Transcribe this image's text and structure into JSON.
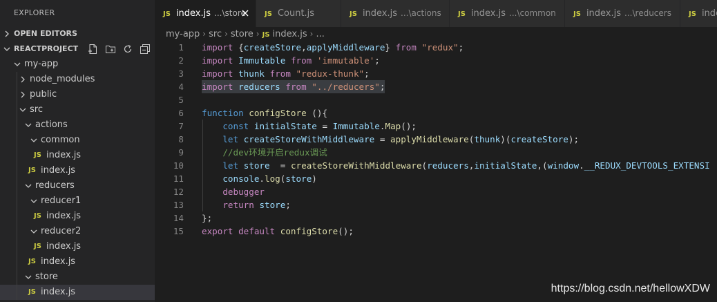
{
  "explorer": {
    "title": "EXPLORER",
    "open_editors": "OPEN EDITORS",
    "project": "REACTPROJECT",
    "tree": [
      {
        "label": "my-app",
        "type": "folder-open"
      },
      {
        "label": "node_modules",
        "type": "folder-closed"
      },
      {
        "label": "public",
        "type": "folder-closed"
      },
      {
        "label": "src",
        "type": "folder-open"
      },
      {
        "label": "actions",
        "type": "folder-open"
      },
      {
        "label": "common",
        "type": "folder-open"
      },
      {
        "label": "index.js",
        "type": "file"
      },
      {
        "label": "index.js",
        "type": "file"
      },
      {
        "label": "reducers",
        "type": "folder-open"
      },
      {
        "label": "reducer1",
        "type": "folder-open"
      },
      {
        "label": "index.js",
        "type": "file"
      },
      {
        "label": "reducer2",
        "type": "folder-open"
      },
      {
        "label": "index.js",
        "type": "file"
      },
      {
        "label": "index.js",
        "type": "file"
      },
      {
        "label": "store",
        "type": "folder-open"
      },
      {
        "label": "index.js",
        "type": "file",
        "selected": true
      }
    ]
  },
  "tabs": [
    {
      "label": "index.js",
      "desc": "...\\store",
      "active": true
    },
    {
      "label": "Count.js",
      "desc": ""
    },
    {
      "label": "index.js",
      "desc": "...\\actions"
    },
    {
      "label": "index.js",
      "desc": "...\\common"
    },
    {
      "label": "index.js",
      "desc": "...\\reducers"
    },
    {
      "label": "inde",
      "desc": ""
    }
  ],
  "file_icon_text": "JS",
  "breadcrumb": [
    "my-app",
    "src",
    "store",
    "index.js",
    "..."
  ],
  "code_lines": [
    "import {createStore,applyMiddleware} from \"redux\";",
    "import Immutable from 'immutable';",
    "import thunk from \"redux-thunk\";",
    "import reducers from \"../reducers\";",
    "",
    "function configStore (){",
    "    const initialState = Immutable.Map();",
    "    let createStoreWithMiddleware = applyMiddleware(thunk)(createStore);",
    "    //dev环境开启redux调试",
    "    let store  = createStoreWithMiddleware(reducers,initialState,(window.__REDUX_DEVTOOLS_EXTENSI",
    "    console.log(store)",
    "    debugger",
    "    return store;",
    "};",
    "export default configStore();"
  ],
  "line_numbers": [
    "1",
    "2",
    "3",
    "4",
    "5",
    "6",
    "7",
    "8",
    "9",
    "10",
    "11",
    "12",
    "13",
    "14",
    "15"
  ],
  "watermark": "https://blog.csdn.net/hellowXDW",
  "colors": {
    "keyword_control": "#c586c0",
    "keyword": "#569cd6",
    "string": "#ce9178",
    "variable": "#9cdcfe",
    "function": "#dcdcaa",
    "comment": "#6a9955",
    "js_icon": "#cbcb41"
  }
}
